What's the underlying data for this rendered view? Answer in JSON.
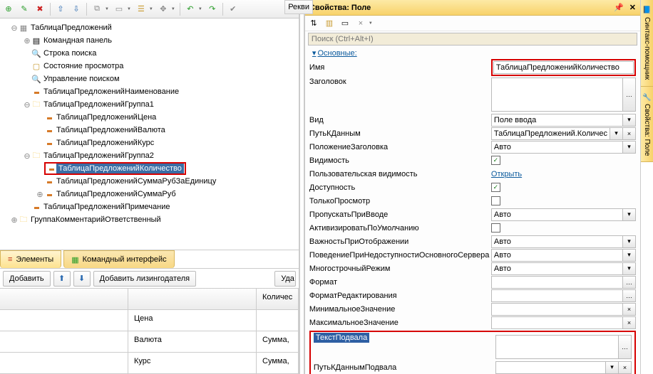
{
  "toolbar": {
    "icons": [
      "add",
      "edit",
      "delete",
      "up",
      "down",
      "copy",
      "layout",
      "tree",
      "arrows",
      "undo",
      "redo",
      "check"
    ]
  },
  "tree": {
    "root": "ТаблицаПредложений",
    "n_cmdpanel": "Командная панель",
    "n_searchrow": "Строка поиска",
    "n_viewstate": "Состояние просмотра",
    "n_searchctrl": "Управление поиском",
    "n_name": "ТаблицаПредложенийНаименование",
    "group1": "ТаблицаПредложенийГруппа1",
    "n_price": "ТаблицаПредложенийЦена",
    "n_currency": "ТаблицаПредложенийВалюта",
    "n_rate": "ТаблицаПредложенийКурс",
    "group2": "ТаблицаПредложенийГруппа2",
    "n_qty": "ТаблицаПредложенийКоличество",
    "n_sumrubper": "ТаблицаПредложенийСуммаРубЗаЕдиницу",
    "n_sumrub": "ТаблицаПредложенийСуммаРуб",
    "n_note": "ТаблицаПредложенийПримечание",
    "group_comment": "ГруппаКомментарийОтветственный"
  },
  "bottom_tabs": {
    "elements": "Элементы",
    "cmdiface": "Командный интерфейс"
  },
  "actions": {
    "add": "Добавить",
    "add_lessor": "Добавить лизингодателя",
    "del_partial": "Уда"
  },
  "grid": {
    "col2_vals": [
      "Цена",
      "Валюта",
      "Курс"
    ],
    "col3_header": "Количес",
    "col3_vals": [
      "Сумма,",
      "Сумма,"
    ]
  },
  "panel": {
    "title": "Свойства: Поле",
    "search_placeholder": "Поиск (Ctrl+Alt+I)",
    "section_main": "Основные:",
    "props": {
      "name_l": "Имя",
      "name_v": "ТаблицаПредложенийКоличество",
      "title_l": "Заголовок",
      "kind_l": "Вид",
      "kind_v": "Поле ввода",
      "datapath_l": "ПутьКДанным",
      "datapath_v": "ТаблицаПредложений.Количес",
      "titlepos_l": "ПоложениеЗаголовка",
      "titlepos_v": "Авто",
      "vis_l": "Видимость",
      "uservis_l": "Пользовательская видимость",
      "uservis_v": "Открыть",
      "avail_l": "Доступность",
      "readonly_l": "ТолькоПросмотр",
      "skipinput_l": "ПропускатьПриВводе",
      "skipinput_v": "Авто",
      "activdef_l": "АктивизироватьПоУмолчанию",
      "dispimp_l": "ВажностьПриОтображении",
      "dispimp_v": "Авто",
      "unavail_l": "ПоведениеПриНедоступностиОсновногоСервера",
      "unavail_v": "Авто",
      "multi_l": "МногострочныйРежим",
      "multi_v": "Авто",
      "format_l": "Формат",
      "editfmt_l": "ФорматРедактирования",
      "min_l": "МинимальноеЗначение",
      "max_l": "МаксимальноеЗначение",
      "footer_text_l": "ТекстПодвала",
      "footer_path_l": "ПутьКДаннымПодвала"
    }
  },
  "sliver": {
    "tab": "Рекви"
  },
  "dock": {
    "syntax": "Синтакс-помощник",
    "propfield": "Свойства: Поле"
  }
}
